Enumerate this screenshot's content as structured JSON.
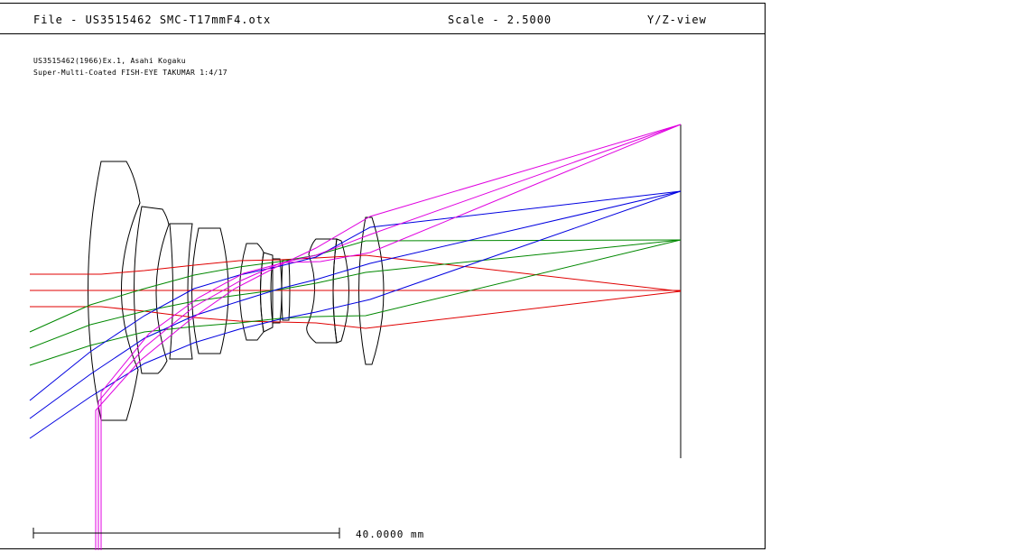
{
  "header": {
    "file_label": "File - US3515462 SMC-T17mmF4.otx",
    "scale_label": "Scale - 2.5000",
    "view_label": "Y/Z-view"
  },
  "description": {
    "line1": "US3515462(1966)Ex.1, Asahi Kogaku",
    "line2": "Super-Multi-Coated FISH-EYE TAKUMAR 1:4/17"
  },
  "scale_bar": {
    "label": "40.0000 mm"
  },
  "colors": {
    "axial_rays": "#e00000",
    "field_1_rays": "#008800",
    "field_2_rays": "#0000e0",
    "field_3_rays": "#e000e0",
    "lens_outline": "#000000"
  }
}
